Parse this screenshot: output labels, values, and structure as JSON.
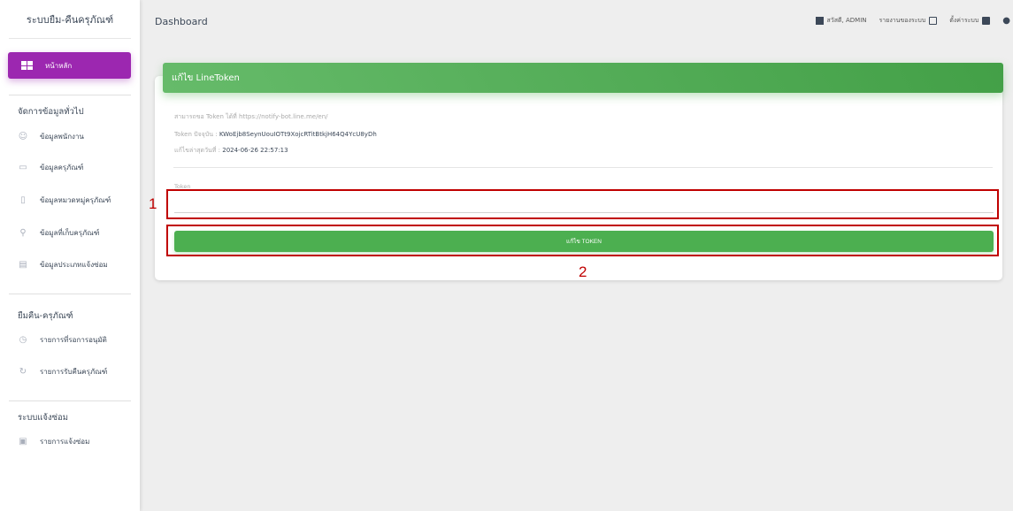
{
  "sidebar": {
    "brand": "ระบบยืม-คืนครุภัณฑ์",
    "active_item": "หน้าหลัก",
    "sections": [
      {
        "title": "จัดการข้อมูลทั่วไป",
        "items": [
          "ข้อมูลพนักงาน",
          "ข้อมูลครุภัณฑ์",
          "ข้อมูลหมวดหมู่ครุภัณฑ์",
          "ข้อมูลที่เก็บครุภัณฑ์",
          "ข้อมูลประเภทแจ้งซ่อม"
        ]
      },
      {
        "title": "ยืมคืน-ครุภัณฑ์",
        "items": [
          "รายการที่รอการอนุมัติ",
          "รายการรับคืนครุภัณฑ์"
        ]
      },
      {
        "title": "ระบบแจ้งซ่อม",
        "items": [
          "รายการแจ้งซ่อม"
        ]
      }
    ]
  },
  "topbar": {
    "breadcrumb": "Dashboard",
    "greeting": "สวัสดี, ADMIN",
    "report": "รายงานของระบบ",
    "settings": "ตั้งค่าระบบ"
  },
  "card": {
    "title": "แก้ไข LineToken",
    "info_source_label": "สามารถขอ Token ได้ที่ https://notify-bot.line.me/en/",
    "info_current_label": "Token ปัจจุบัน : ",
    "info_current_value": "KWoEjb8SeynUouIOTt9XojcRTitBtkjH64Q4YcU8yDh",
    "info_updated_label": "แก้ไขล่าสุดวันที่ : ",
    "info_updated_value": "2024-06-26 22:57:13",
    "token_label": "Token",
    "token_value": "",
    "submit_label": "แก้ไข TOKEN"
  },
  "annotations": {
    "a1": "1",
    "a2": "2"
  },
  "colors": {
    "primary": "#9c27b0",
    "success": "#4caf50",
    "annotation": "#c00000"
  }
}
